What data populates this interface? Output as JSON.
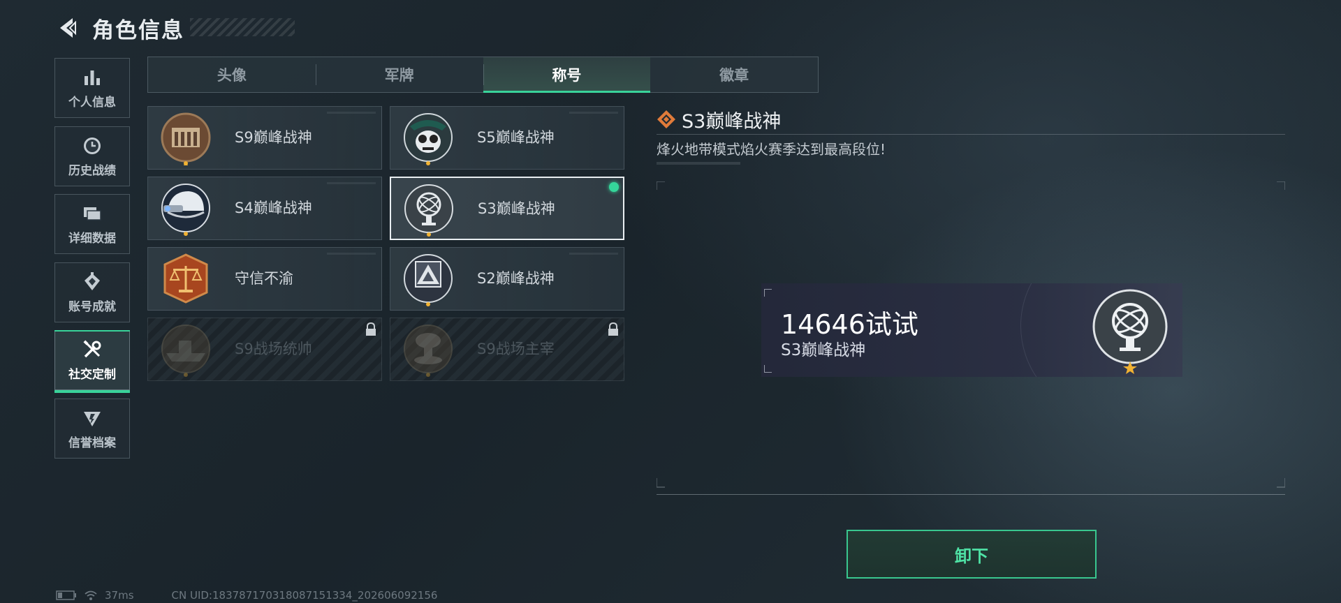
{
  "header": {
    "title": "角色信息"
  },
  "sidebar": {
    "items": [
      {
        "label": "个人信息",
        "icon": "bar-chart-icon"
      },
      {
        "label": "历史战绩",
        "icon": "clock-icon"
      },
      {
        "label": "详细数据",
        "icon": "folder-icon"
      },
      {
        "label": "账号成就",
        "icon": "achievement-icon"
      },
      {
        "label": "社交定制",
        "icon": "wrench-icon",
        "active": true
      },
      {
        "label": "信誉档案",
        "icon": "shield-icon"
      }
    ]
  },
  "tabs": [
    {
      "label": "头像"
    },
    {
      "label": "军牌"
    },
    {
      "label": "称号",
      "active": true
    },
    {
      "label": "徽章"
    }
  ],
  "titles": [
    {
      "name": "S9巅峰战神",
      "emblem": "fortress-emblem-icon",
      "locked": false
    },
    {
      "name": "S5巅峰战神",
      "emblem": "soldier-skull-emblem-icon",
      "locked": false
    },
    {
      "name": "S4巅峰战神",
      "emblem": "helmet-emblem-icon",
      "locked": false
    },
    {
      "name": "S3巅峰战神",
      "emblem": "armillary-sphere-emblem-icon",
      "locked": false,
      "selected": true
    },
    {
      "name": "守信不渝",
      "emblem": "scales-emblem-icon",
      "locked": false
    },
    {
      "name": "S2巅峰战神",
      "emblem": "pyramid-emblem-icon",
      "locked": false
    },
    {
      "name": "S9战场统帅",
      "emblem": "warship-emblem-icon",
      "locked": true
    },
    {
      "name": "S9战场主宰",
      "emblem": "mushroom-cloud-emblem-icon",
      "locked": true
    }
  ],
  "detail": {
    "title": "S3巅峰战神",
    "description": "烽火地带模式焰火赛季达到最高段位!"
  },
  "nameplate": {
    "player_name": "14646试试",
    "title": "S3巅峰战神"
  },
  "actions": {
    "unequip_label": "卸下"
  },
  "status": {
    "ping": "37ms",
    "uid": "CN UID:18378717031808715133​4_202606092156"
  },
  "colors": {
    "accent": "#39d39a",
    "gold_star": "#f1b233",
    "bronze": "#b47a4a"
  }
}
